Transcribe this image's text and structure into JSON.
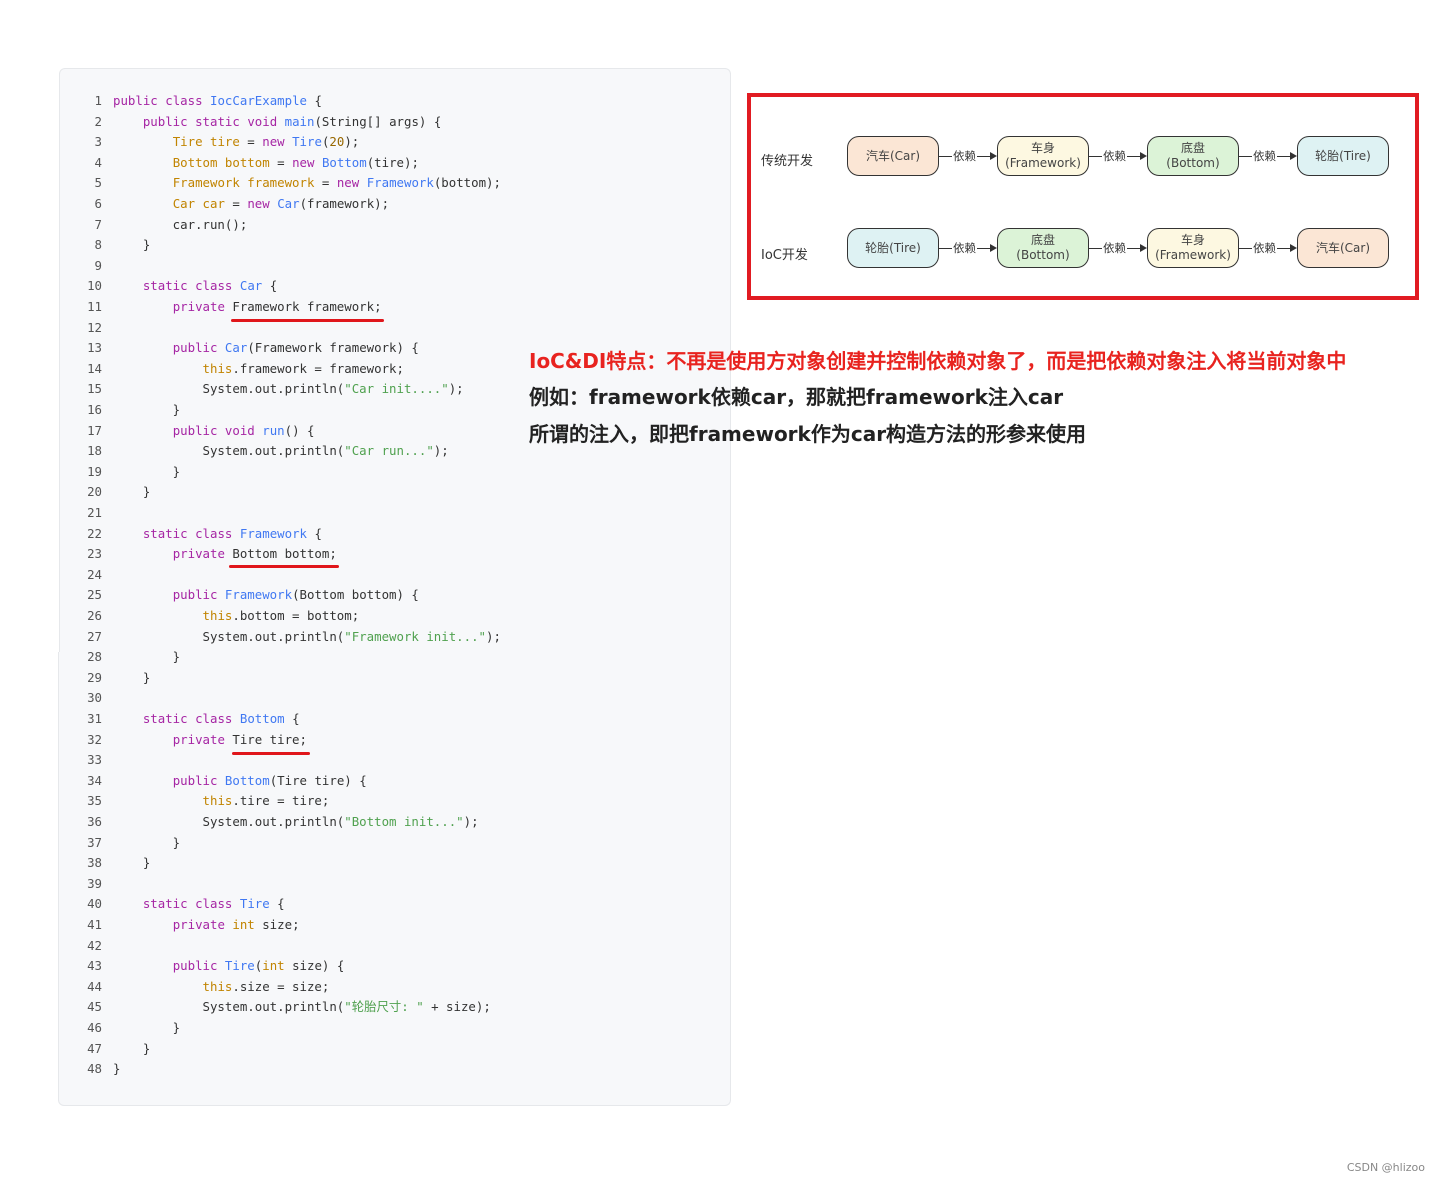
{
  "code": {
    "lines": [
      {
        "n": "1",
        "html": "<span class=\"tok-kw\">public</span> <span class=\"tok-kw\">class</span> <span class=\"tok-fn\">IocCarExample</span> {"
      },
      {
        "n": "2",
        "html": "    <span class=\"tok-kw\">public</span> <span class=\"tok-kw\">static</span> <span class=\"tok-kw\">void</span> <span class=\"tok-fn\">main</span>(String[] args) {"
      },
      {
        "n": "3",
        "html": "        <span class=\"tok-type\">Tire</span> <span class=\"tok-type\">tire</span> = <span class=\"tok-kw\">new</span> <span class=\"tok-fn\">Tire</span>(<span class=\"tok-num\">20</span>);"
      },
      {
        "n": "4",
        "html": "        <span class=\"tok-type\">Bottom</span> <span class=\"tok-type\">bottom</span> = <span class=\"tok-kw\">new</span> <span class=\"tok-fn\">Bottom</span>(tire);"
      },
      {
        "n": "5",
        "html": "        <span class=\"tok-type\">Framework</span> <span class=\"tok-type\">framework</span> = <span class=\"tok-kw\">new</span> <span class=\"tok-fn\">Framework</span>(bottom);"
      },
      {
        "n": "6",
        "html": "        <span class=\"tok-type\">Car</span> <span class=\"tok-type\">car</span> = <span class=\"tok-kw\">new</span> <span class=\"tok-fn\">Car</span>(framework);"
      },
      {
        "n": "7",
        "html": "        car.run();"
      },
      {
        "n": "8",
        "html": "    }"
      },
      {
        "n": "9",
        "html": ""
      },
      {
        "n": "10",
        "html": "    <span class=\"tok-kw\">static</span> <span class=\"tok-kw\">class</span> <span class=\"tok-fn\">Car</span> {"
      },
      {
        "n": "11",
        "html": "        <span class=\"tok-kw\">private</span> Framework framework;"
      },
      {
        "n": "12",
        "html": ""
      },
      {
        "n": "13",
        "html": "        <span class=\"tok-kw\">public</span> <span class=\"tok-fn\">Car</span>(Framework framework) {"
      },
      {
        "n": "14",
        "html": "            <span class=\"tok-this\">this</span>.framework = framework;"
      },
      {
        "n": "15",
        "html": "            System.out.println(<span class=\"tok-str\">\"Car init....\"</span>);"
      },
      {
        "n": "16",
        "html": "        }"
      },
      {
        "n": "17",
        "html": "        <span class=\"tok-kw\">public</span> <span class=\"tok-kw\">void</span> <span class=\"tok-fn\">run</span>() {"
      },
      {
        "n": "18",
        "html": "            System.out.println(<span class=\"tok-str\">\"Car run...\"</span>);"
      },
      {
        "n": "19",
        "html": "        }"
      },
      {
        "n": "20",
        "html": "    }"
      },
      {
        "n": "21",
        "html": ""
      },
      {
        "n": "22",
        "html": "    <span class=\"tok-kw\">static</span> <span class=\"tok-kw\">class</span> <span class=\"tok-fn\">Framework</span> {"
      },
      {
        "n": "23",
        "html": "        <span class=\"tok-kw\">private</span> Bottom bottom;"
      },
      {
        "n": "24",
        "html": ""
      },
      {
        "n": "25",
        "html": "        <span class=\"tok-kw\">public</span> <span class=\"tok-fn\">Framework</span>(Bottom bottom) {"
      },
      {
        "n": "26",
        "html": "            <span class=\"tok-this\">this</span>.bottom = bottom;"
      },
      {
        "n": "27",
        "html": "            System.out.println(<span class=\"tok-str\">\"Framework init...\"</span>);"
      },
      {
        "n": "28",
        "html": "        }"
      },
      {
        "n": "29",
        "html": "    }"
      },
      {
        "n": "30",
        "html": ""
      },
      {
        "n": "31",
        "html": "    <span class=\"tok-kw\">static</span> <span class=\"tok-kw\">class</span> <span class=\"tok-fn\">Bottom</span> {"
      },
      {
        "n": "32",
        "html": "        <span class=\"tok-kw\">private</span> Tire tire;"
      },
      {
        "n": "33",
        "html": ""
      },
      {
        "n": "34",
        "html": "        <span class=\"tok-kw\">public</span> <span class=\"tok-fn\">Bottom</span>(Tire tire) {"
      },
      {
        "n": "35",
        "html": "            <span class=\"tok-this\">this</span>.tire = tire;"
      },
      {
        "n": "36",
        "html": "            System.out.println(<span class=\"tok-str\">\"Bottom init...\"</span>);"
      },
      {
        "n": "37",
        "html": "        }"
      },
      {
        "n": "38",
        "html": "    }"
      },
      {
        "n": "39",
        "html": ""
      },
      {
        "n": "40",
        "html": "    <span class=\"tok-kw\">static</span> <span class=\"tok-kw\">class</span> <span class=\"tok-fn\">Tire</span> {"
      },
      {
        "n": "41",
        "html": "        <span class=\"tok-kw\">private</span> <span class=\"tok-type\">int</span> size;"
      },
      {
        "n": "42",
        "html": ""
      },
      {
        "n": "43",
        "html": "        <span class=\"tok-kw\">public</span> <span class=\"tok-fn\">Tire</span>(<span class=\"tok-type\">int</span> size) {"
      },
      {
        "n": "44",
        "html": "            <span class=\"tok-this\">this</span>.size = size;"
      },
      {
        "n": "45",
        "html": "            System.out.println(<span class=\"tok-str\">\"轮胎尺寸: \"</span> + size);"
      },
      {
        "n": "46",
        "html": "        }"
      },
      {
        "n": "47",
        "html": "    }"
      },
      {
        "n": "48",
        "html": "}"
      }
    ]
  },
  "diagram": {
    "rows": [
      {
        "label": "传统开发",
        "nodes": [
          {
            "text": [
              "汽车(Car)"
            ],
            "color": "#fbe6d5"
          },
          {
            "text": [
              "车身",
              "(Framework)"
            ],
            "color": "#fdf8e1"
          },
          {
            "text": [
              "底盘",
              "(Bottom)"
            ],
            "color": "#dcf3d7"
          },
          {
            "text": [
              "轮胎(Tire)"
            ],
            "color": "#def2f3"
          }
        ],
        "edge_label": "依赖"
      },
      {
        "label": "IoC开发",
        "nodes": [
          {
            "text": [
              "轮胎(Tire)"
            ],
            "color": "#def2f3"
          },
          {
            "text": [
              "底盘",
              "(Bottom)"
            ],
            "color": "#dcf3d7"
          },
          {
            "text": [
              "车身",
              "(Framework)"
            ],
            "color": "#fdf8e1"
          },
          {
            "text": [
              "汽车(Car)"
            ],
            "color": "#fbe6d5"
          }
        ],
        "edge_label": "依赖"
      }
    ]
  },
  "notes": [
    "IoC&DI特点：不再是使用方对象创建并控制依赖对象了，而是把依赖对象注入将当前对象中",
    "例如：framework依赖car，那就把framework注入car",
    "所谓的注入，即把framework作为car构造方法的形参来使用"
  ],
  "watermark": "CSDN @hlizoo",
  "colors": {
    "highlight": "#e0161b",
    "box_border": "#e11b22"
  }
}
